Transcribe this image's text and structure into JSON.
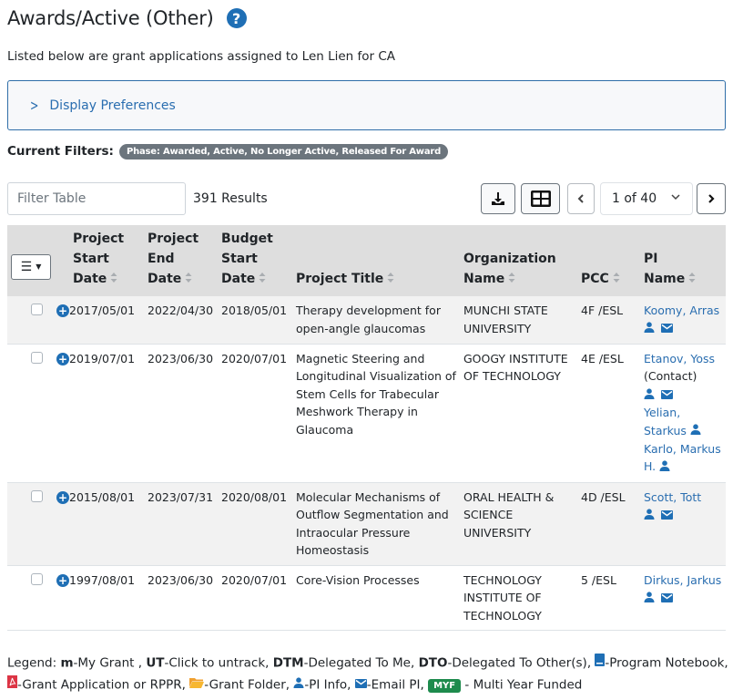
{
  "header": {
    "title": "Awards/Active (Other)",
    "help_icon": "question-circle-icon",
    "subtitle": "Listed below are grant applications assigned to  Len Lien for CA"
  },
  "display_preferences": {
    "label": "Display Preferences",
    "icon": "chevron-right-icon"
  },
  "filters": {
    "label": "Current Filters:",
    "badges": [
      "Phase: Awarded, Active, No Longer Active, Released For Award"
    ]
  },
  "toolbar": {
    "filter_placeholder": "Filter Table",
    "filter_value": "",
    "results": "391 Results",
    "download_icon": "download-icon",
    "grid_icon": "table-grid-icon",
    "prev_icon": "chevron-left-icon",
    "page_label": "1 of 40",
    "next_icon": "chevron-right-icon"
  },
  "table": {
    "columns": [
      {
        "key": "menu",
        "label": ""
      },
      {
        "key": "start",
        "lines": [
          "Project",
          "Start",
          "Date"
        ]
      },
      {
        "key": "end",
        "lines": [
          "Project",
          "End",
          "Date"
        ]
      },
      {
        "key": "budget",
        "lines": [
          "Budget",
          "Start",
          "Date"
        ]
      },
      {
        "key": "title",
        "lines": [
          "Project Title"
        ]
      },
      {
        "key": "org",
        "lines": [
          "Organization",
          "Name"
        ]
      },
      {
        "key": "pcc",
        "lines": [
          "PCC"
        ]
      },
      {
        "key": "pi",
        "lines": [
          "PI",
          "Name"
        ]
      }
    ],
    "rows": [
      {
        "start": "2017/05/01",
        "end": "2022/04/30",
        "budget": "2018/05/01",
        "title": "Therapy development for open-angle glaucomas",
        "org": "MUNCHI STATE UNIVERSITY",
        "pcc": "4F /ESL",
        "pis": [
          {
            "name": "Koomy, Arras",
            "suffix": "",
            "person": true,
            "email": true
          }
        ]
      },
      {
        "start": "2019/07/01",
        "end": "2023/06/30",
        "budget": "2020/07/01",
        "title": "Magnetic Steering and Longitudinal Visualization of Stem Cells for Trabecular Meshwork Therapy in Glaucoma",
        "org": "GOOGY  INSTITUTE OF TECHNOLOGY",
        "pcc": "4E /ESL",
        "pis": [
          {
            "name": "Etanov,  Yoss",
            "suffix": "(Contact)",
            "person": true,
            "email": true
          },
          {
            "name": "Yelian, Starkus",
            "suffix": "",
            "person": true,
            "email": false
          },
          {
            "name": "Karlo, Markus H.",
            "suffix": "",
            "person": true,
            "email": false
          }
        ]
      },
      {
        "start": "2015/08/01",
        "end": "2023/07/31",
        "budget": "2020/08/01",
        "title": "Molecular Mechanisms of Outflow Segmentation and Intraocular Pressure Homeostasis",
        "org": "ORAL HEALTH & SCIENCE UNIVERSITY",
        "pcc": "4D /ESL",
        "pis": [
          {
            "name": "Scott, Tott",
            "suffix": "",
            "person": true,
            "email": true
          }
        ]
      },
      {
        "start": "1997/08/01",
        "end": "2023/06/30",
        "budget": "2020/07/01",
        "title": "Core-Vision Processes",
        "org": "TECHNOLOGY INSTITUTE OF TECHNOLOGY",
        "pcc": "5 /ESL",
        "pis": [
          {
            "name": "Dirkus, Jarkus",
            "suffix": "",
            "person": true,
            "email": true
          }
        ]
      }
    ]
  },
  "legend": {
    "prefix": "Legend: ",
    "items": [
      {
        "bold": "m",
        "text": "-My Grant , "
      },
      {
        "bold": "UT",
        "text": "-Click to untrack, "
      },
      {
        "bold": "DTM",
        "text": "-Delegated To Me, "
      },
      {
        "bold": "DTO",
        "text": "-Delegated To Other(s), "
      },
      {
        "icon": "program-notebook-icon",
        "text": "-Program Notebook,"
      },
      {
        "icon": "pdf-file-icon",
        "text": "-Grant Application or RPPR, "
      },
      {
        "icon": "folder-icon",
        "text": "-Grant Folder, "
      },
      {
        "icon": "person-icon",
        "text": "-PI Info, "
      },
      {
        "icon": "envelope-icon",
        "text": "-Email PI, "
      },
      {
        "badge": "MYF",
        "text": " - Multi Year Funded"
      }
    ]
  },
  "colors": {
    "primary": "#1f6fb5",
    "link": "#2a6eb0",
    "badge_gray": "#6c757d",
    "myf_green": "#1e8b4d",
    "header_bg": "#dedede",
    "stripe_bg": "#f2f2f2"
  }
}
